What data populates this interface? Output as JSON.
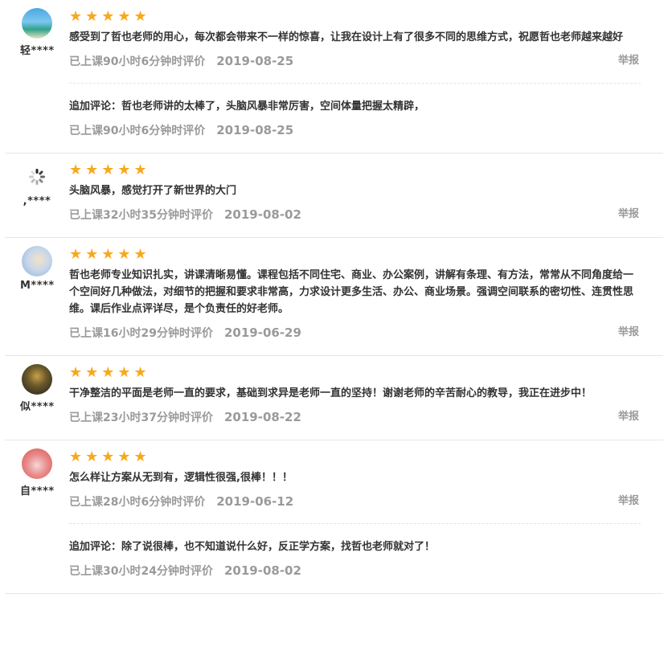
{
  "reviews": [
    {
      "username": "轻****",
      "stars": "★★★★★",
      "text": "感受到了哲也老师的用心，每次都会带来不一样的惊喜，让我在设计上有了很多不同的思维方式，祝愿哲也老师越来越好",
      "duration": "已上课90小时6分钟时评价",
      "date": "2019-08-25",
      "report": "举报",
      "followup": {
        "text": "追加评论：哲也老师讲的太棒了，头脑风暴非常厉害，空间体量把握太精辟，",
        "duration": "已上课90小时6分钟时评价",
        "date": "2019-08-25"
      }
    },
    {
      "username": ",****",
      "stars": "★★★★★",
      "text": "头脑风暴，感觉打开了新世界的大门",
      "duration": "已上课32小时35分钟时评价",
      "date": "2019-08-02",
      "report": "举报"
    },
    {
      "username": "M****",
      "stars": "★★★★★",
      "text": "哲也老师专业知识扎实，讲课清晰易懂。课程包括不同住宅、商业、办公案例，讲解有条理、有方法，常常从不同角度给一个空间好几种做法，对细节的把握和要求非常高，力求设计更多生活、办公、商业场景。强调空间联系的密切性、连贯性思维。课后作业点评详尽，是个负责任的好老师。",
      "duration": "已上课16小时29分钟时评价",
      "date": "2019-06-29",
      "report": "举报"
    },
    {
      "username": "似****",
      "stars": "★★★★★",
      "text": "干净整洁的平面是老师一直的要求，基础到求异是老师一直的坚持！谢谢老师的辛苦耐心的教导，我正在进步中！",
      "duration": "已上课23小时37分钟时评价",
      "date": "2019-08-22",
      "report": "举报"
    },
    {
      "username": "自****",
      "stars": "★★★★★",
      "text": "怎么样让方案从无到有，逻辑性很强,很棒！！！",
      "duration": "已上课28小时6分钟时评价",
      "date": "2019-06-12",
      "report": "举报",
      "followup": {
        "text": "追加评论：除了说很棒，也不知道说什么好，反正学方案，找哲也老师就对了！",
        "duration": "已上课30小时24分钟时评价",
        "date": "2019-08-02"
      }
    }
  ],
  "colors": {
    "star": "#f9a81b",
    "meta": "#9a9a9a",
    "text": "#333333",
    "divider": "#e6e6e6"
  }
}
